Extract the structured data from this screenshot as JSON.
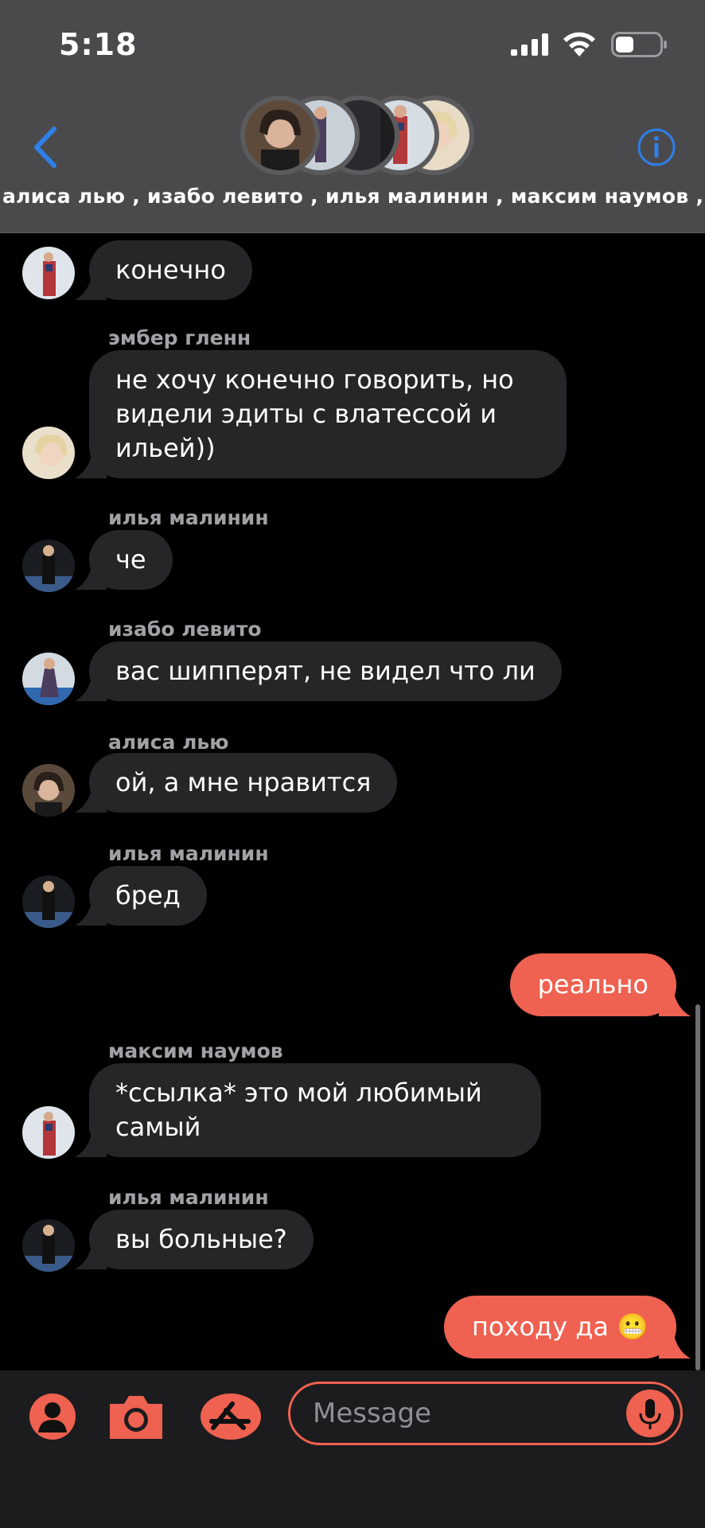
{
  "status_bar": {
    "time": "5:18",
    "signal_icon": "cellular-signal-icon",
    "wifi_icon": "wifi-icon",
    "battery_icon": "battery-icon",
    "battery_level": 0.4
  },
  "header": {
    "back_icon": "chevron-left-icon",
    "info_icon": "info-icon",
    "members": "алиса лью , изабо левито , илья малинин , максим наумов , эмбер гленн"
  },
  "partial_sender": "максим наумов",
  "messages": [
    {
      "sender": "",
      "text": "конечно",
      "avatar": "maksim"
    },
    {
      "sender": "эмбер гленн",
      "text": "не хочу конечно говорить, но видели эдиты с влатессой и ильей))",
      "avatar": "amber"
    },
    {
      "sender": "илья малинин",
      "text": "че",
      "avatar": "ilya"
    },
    {
      "sender": "изабо левито",
      "text": "вас шипперят, не видел что ли",
      "avatar": "isabeau"
    },
    {
      "sender": "алиса лью",
      "text": "ой, а мне нравится",
      "avatar": "alysa"
    },
    {
      "sender": "илья малинин",
      "text": "бред",
      "avatar": "ilya"
    },
    {
      "sender": "",
      "text": "реально",
      "outgoing": true
    },
    {
      "sender": "максим наумов",
      "text": "*ссылка* это мой любимый самый",
      "avatar": "maksim"
    },
    {
      "sender": "илья малинин",
      "text": "вы больные?",
      "avatar": "ilya"
    },
    {
      "sender": "",
      "text": "походу да 😬",
      "outgoing": true
    }
  ],
  "input_bar": {
    "contact_icon": "person-icon",
    "camera_icon": "camera-icon",
    "appstore_icon": "app-store-icon",
    "placeholder": "Message",
    "mic_icon": "microphone-icon"
  },
  "colors": {
    "accent": "#ef6150",
    "incoming_bubble": "#262628",
    "header_bg": "#4a4a4c",
    "link_blue": "#2f7fe8"
  }
}
